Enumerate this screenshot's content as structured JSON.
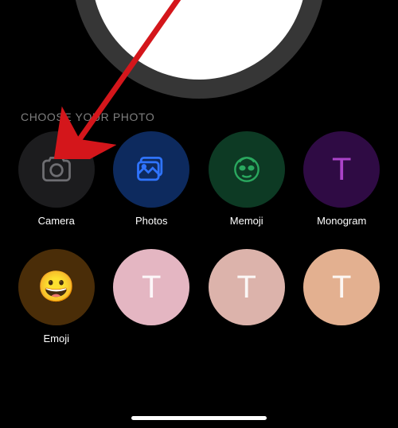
{
  "section_header": "CHOOSE YOUR PHOTO",
  "options": {
    "camera": {
      "label": "Camera"
    },
    "photos": {
      "label": "Photos"
    },
    "memoji": {
      "label": "Memoji"
    },
    "monogram": {
      "label": "Monogram",
      "letter": "T"
    },
    "emoji": {
      "label": "Emoji",
      "glyph": "😀"
    },
    "preset1": {
      "letter": "T"
    },
    "preset2": {
      "letter": "T"
    },
    "preset3": {
      "letter": "T"
    }
  }
}
